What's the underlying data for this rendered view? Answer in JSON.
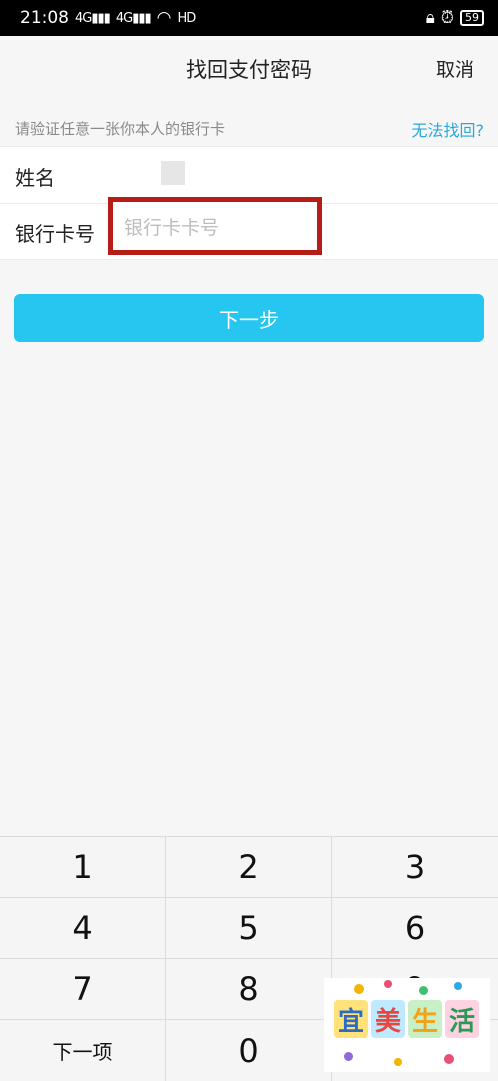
{
  "status_bar": {
    "time": "21:08",
    "signal1": "4G",
    "signal2": "4G",
    "hd": "HD",
    "battery": "59"
  },
  "nav": {
    "title": "找回支付密码",
    "cancel_label": "取消"
  },
  "hint": {
    "text": "请验证任意一张你本人的银行卡",
    "link": "无法找回?"
  },
  "form": {
    "name_label": "姓名",
    "card_label": "银行卡号",
    "card_value": "",
    "card_placeholder": "银行卡卡号"
  },
  "next_button": "下一步",
  "keypad": {
    "keys": [
      "1",
      "2",
      "3",
      "4",
      "5",
      "6",
      "7",
      "8",
      "9",
      "下一项",
      "0",
      ""
    ]
  },
  "watermark": {
    "chars": [
      "宜",
      "美",
      "生",
      "活"
    ]
  },
  "colors": {
    "accent": "#26c6f1",
    "link": "#27a9d8",
    "highlight": "#b51d16"
  }
}
